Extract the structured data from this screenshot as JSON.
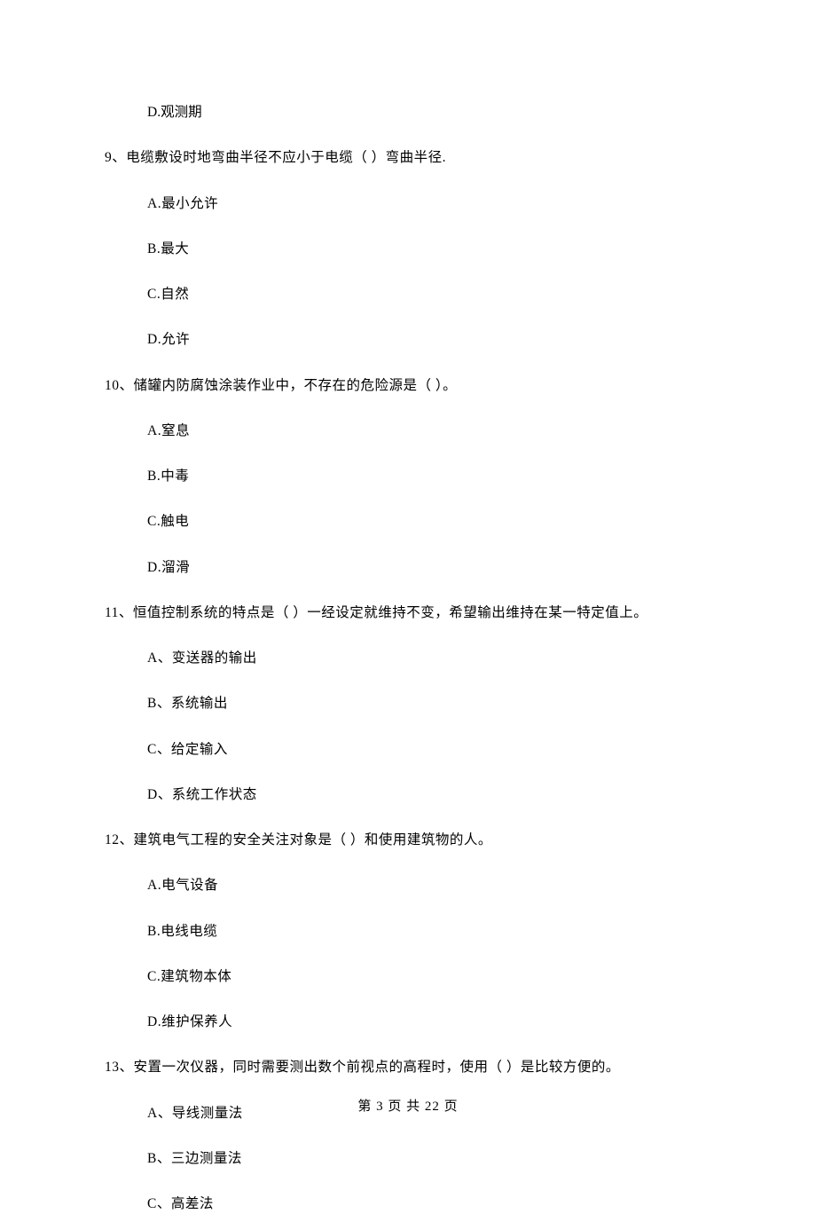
{
  "orphan_option": "D.观测期",
  "questions": [
    {
      "text": "9、电缆敷设时地弯曲半径不应小于电缆（    ）弯曲半径.",
      "options": [
        "A.最小允许",
        "B.最大",
        "C.自然",
        "D.允许"
      ]
    },
    {
      "text": "10、储罐内防腐蚀涂装作业中，不存在的危险源是（    ）。",
      "options": [
        "A.窒息",
        "B.中毒",
        "C.触电",
        "D.溜滑"
      ]
    },
    {
      "text": "11、恒值控制系统的特点是（    ）一经设定就维持不变，希望输出维持在某一特定值上。",
      "options": [
        "A、变送器的输出",
        "B、系统输出",
        "C、给定输入",
        "D、系统工作状态"
      ]
    },
    {
      "text": "12、建筑电气工程的安全关注对象是（    ）和使用建筑物的人。",
      "options": [
        "A.电气设备",
        "B.电线电缆",
        "C.建筑物本体",
        "D.维护保养人"
      ]
    },
    {
      "text": "13、安置一次仪器，同时需要测出数个前视点的高程时，使用（    ）是比较方便的。",
      "options": [
        "A、导线测量法",
        "B、三边测量法",
        "C、高差法"
      ]
    }
  ],
  "pager": "第 3 页 共 22 页"
}
